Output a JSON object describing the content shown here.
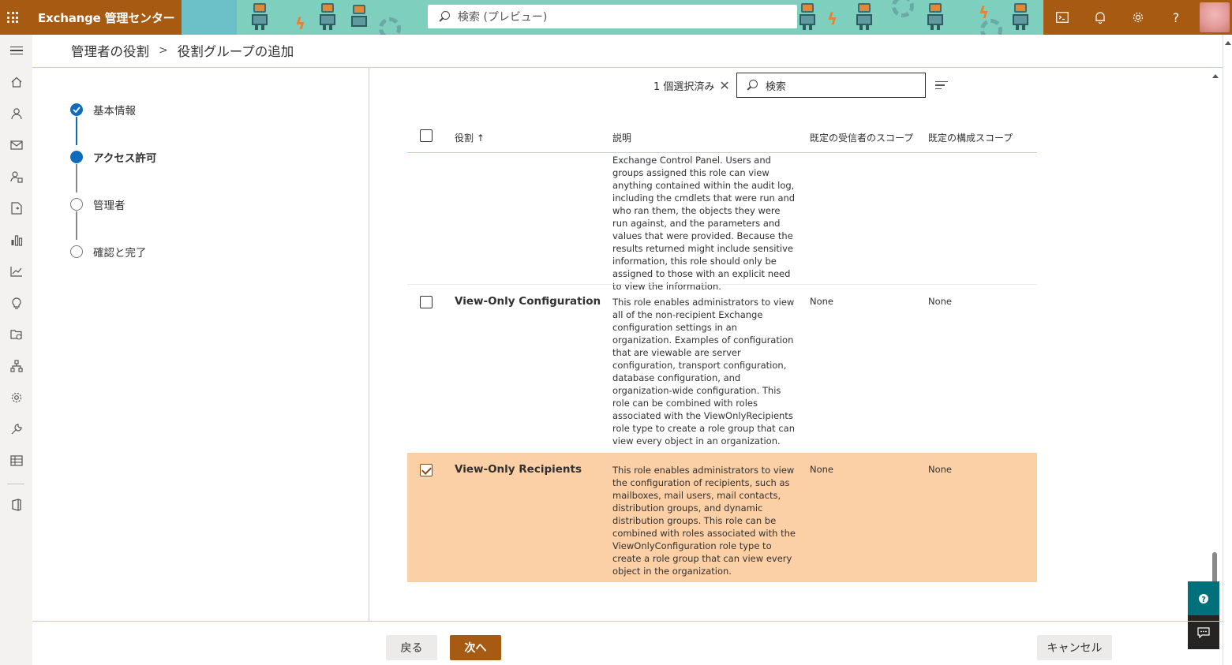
{
  "app": {
    "title": "Exchange 管理センター"
  },
  "search": {
    "placeholder": "検索 (プレビュー)"
  },
  "breadcrumb": {
    "parent": "管理者の役割",
    "current": "役割グループの追加"
  },
  "wizard": {
    "steps": [
      {
        "label": "基本情報",
        "state": "done"
      },
      {
        "label": "アクセス許可",
        "state": "current"
      },
      {
        "label": "管理者",
        "state": "todo"
      },
      {
        "label": "確認と完了",
        "state": "todo"
      }
    ]
  },
  "toolbar": {
    "selected_count": "1 個選択済み",
    "search_placeholder": "検索"
  },
  "table": {
    "headers": {
      "role": "役割 ↑",
      "description": "説明",
      "recipient_scope": "既定の受信者のスコープ",
      "config_scope": "既定の構成スコープ"
    },
    "rows": [
      {
        "name": "",
        "description": "Exchange Control Panel. Users and groups assigned this role can view anything contained within the audit log, including the cmdlets that were run and who ran them, the objects they were run against, and the parameters and values that were provided. Because the results returned might include sensitive information, this role should only be assigned to those with an explicit need to view the information.",
        "recipient_scope": "",
        "config_scope": "",
        "selected": false
      },
      {
        "name": "View-Only Configuration",
        "description": "This role enables administrators to view all of the non-recipient Exchange configuration settings in an organization. Examples of configuration that are viewable are server configuration, transport configuration, database configuration, and organization-wide configuration. This role can be combined with roles associated with the ViewOnlyRecipients role type to create a role group that can view every object in an organization.",
        "recipient_scope": "None",
        "config_scope": "None",
        "selected": false
      },
      {
        "name": "View-Only Recipients",
        "description": "This role enables administrators to view the configuration of recipients, such as mailboxes, mail users, mail contacts, distribution groups, and dynamic distribution groups. This role can be combined with roles associated with the ViewOnlyConfiguration role type to create a role group that can view every object in the organization.",
        "recipient_scope": "None",
        "config_scope": "None",
        "selected": true
      }
    ]
  },
  "footer": {
    "back": "戻る",
    "next": "次へ",
    "cancel": "キャンセル"
  },
  "colors": {
    "brand": "#a75a12",
    "accent_blue": "#0f6cbd",
    "selected_row": "#fcd0a6",
    "divider": "#f0c48c"
  }
}
